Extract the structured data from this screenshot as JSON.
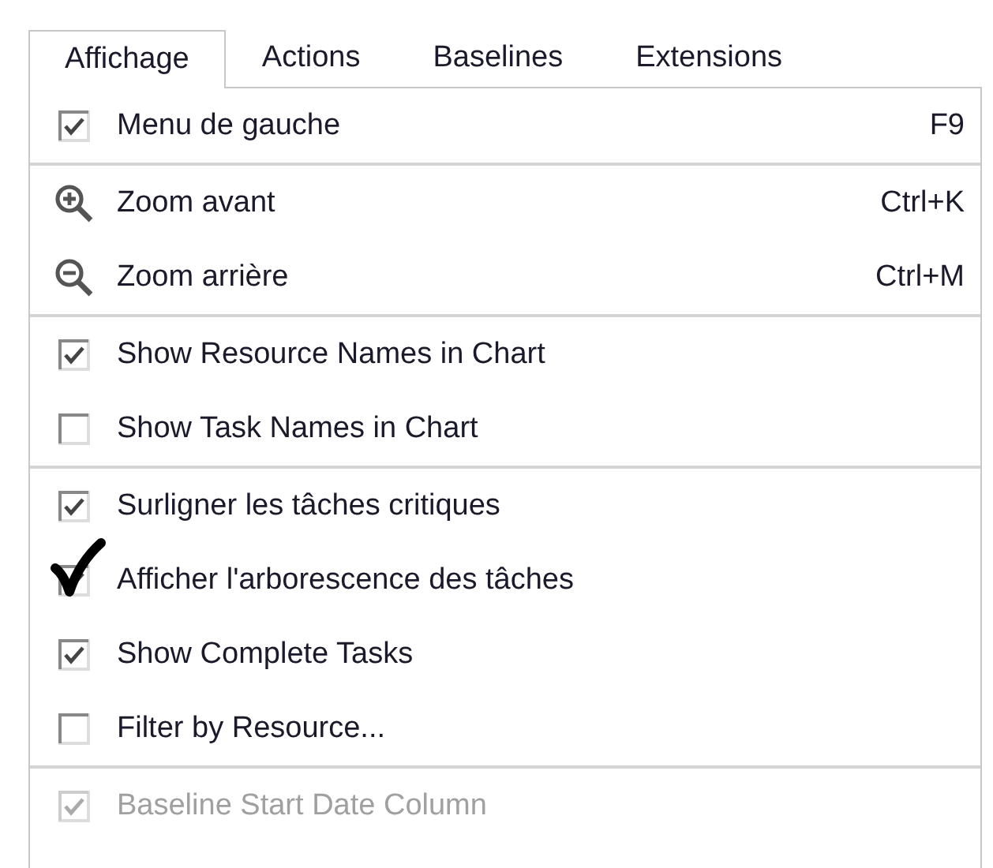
{
  "tabs": [
    {
      "label": "Affichage",
      "selected": true
    },
    {
      "label": "Actions",
      "selected": false
    },
    {
      "label": "Baselines",
      "selected": false
    },
    {
      "label": "Extensions",
      "selected": false
    }
  ],
  "menu": {
    "sections": [
      {
        "items": [
          {
            "kind": "checkbox",
            "label": "Menu de gauche",
            "checked": true,
            "disabled": false,
            "shortcut": "F9"
          }
        ]
      },
      {
        "items": [
          {
            "kind": "zoom-in",
            "label": "Zoom avant",
            "shortcut": "Ctrl+K"
          },
          {
            "kind": "zoom-out",
            "label": "Zoom arrière",
            "shortcut": "Ctrl+M"
          }
        ]
      },
      {
        "items": [
          {
            "kind": "checkbox",
            "label": "Show Resource Names in Chart",
            "checked": true,
            "disabled": false
          },
          {
            "kind": "checkbox",
            "label": "Show Task Names in Chart",
            "checked": false,
            "disabled": false
          }
        ]
      },
      {
        "items": [
          {
            "kind": "checkbox",
            "label": "Surligner les tâches critiques",
            "checked": true,
            "disabled": false
          },
          {
            "kind": "checkbox",
            "label": "Afficher l'arborescence des tâches",
            "checked": true,
            "disabled": false,
            "annotated": true
          },
          {
            "kind": "checkbox",
            "label": "Show Complete Tasks",
            "checked": true,
            "disabled": false
          },
          {
            "kind": "checkbox",
            "label": "Filter by Resource...",
            "checked": false,
            "disabled": false
          }
        ]
      },
      {
        "items": [
          {
            "kind": "checkbox",
            "label": "Baseline Start Date Column",
            "checked": true,
            "disabled": true
          }
        ]
      }
    ]
  }
}
